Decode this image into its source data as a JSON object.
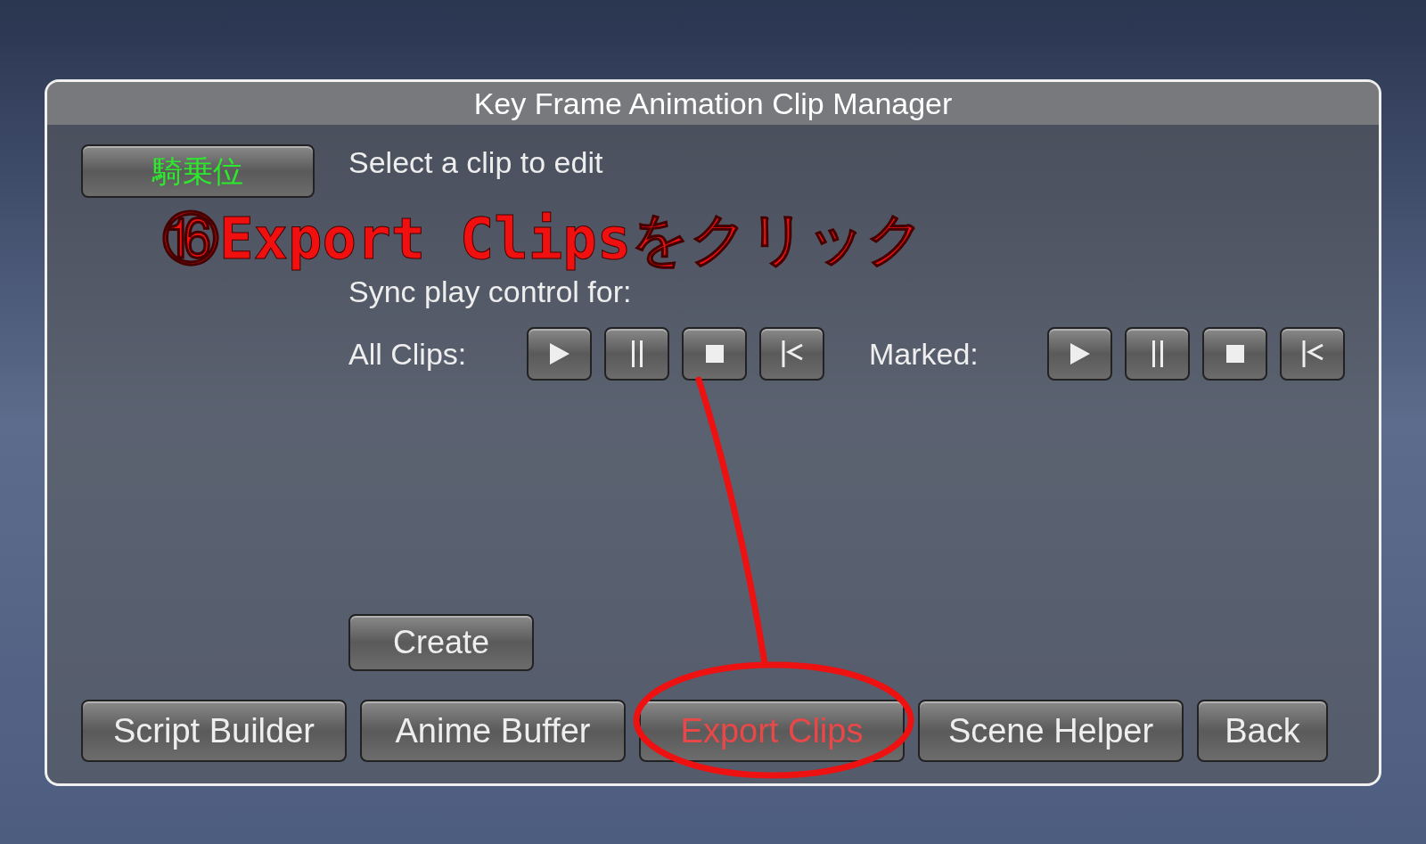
{
  "window": {
    "title": "Key Frame Animation Clip Manager"
  },
  "character_button": {
    "label": "騎乗位"
  },
  "prompt": "Select a clip to edit",
  "sync": {
    "heading": "Sync play control for:",
    "groups": [
      {
        "label": "All Clips:",
        "controls": [
          {
            "kind": "play"
          },
          {
            "kind": "pause"
          },
          {
            "kind": "stop"
          },
          {
            "kind": "rewind"
          }
        ]
      },
      {
        "label": "Marked:",
        "controls": [
          {
            "kind": "play"
          },
          {
            "kind": "pause"
          },
          {
            "kind": "stop"
          },
          {
            "kind": "rewind"
          }
        ]
      }
    ]
  },
  "create_button": {
    "label": "Create"
  },
  "bottom_buttons": [
    {
      "label": "Script Builder",
      "highlighted": false
    },
    {
      "label": "Anime Buffer",
      "highlighted": false
    },
    {
      "label": "Export Clips",
      "highlighted": true
    },
    {
      "label": "Scene Helper",
      "highlighted": false
    },
    {
      "label": "Back",
      "highlighted": false
    }
  ],
  "annotation": {
    "text": "⑯Export Clipsをクリック"
  }
}
